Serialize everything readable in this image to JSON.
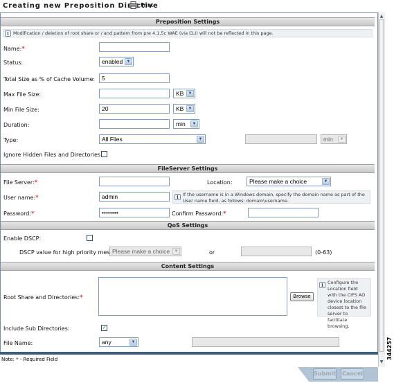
{
  "title": "Creating new Preposition Directive",
  "print_label": "Print",
  "note": "Modification / deletion of root share or / and pattern from pre 4.1.5c WAE (via CLI) will not be reflected in this page.",
  "sections": {
    "preposition": "Preposition Settings",
    "fileserver": "FileServer Settings",
    "qos": "QoS Settings",
    "content": "Content Settings"
  },
  "fields": {
    "name_label": "Name:",
    "name_value": "",
    "status_label": "Status:",
    "status_value": "enabled",
    "total_size_label": "Total Size as % of Cache Volume:",
    "total_size_value": "5",
    "max_file_label": "Max File Size:",
    "max_file_value": "",
    "max_file_unit": "KB",
    "min_file_label": "Min File Size:",
    "min_file_value": "20",
    "min_file_unit": "KB",
    "duration_label": "Duration:",
    "duration_value": "",
    "duration_unit": "min",
    "type_label": "Type:",
    "type_value": "All Files",
    "type_extra_unit": "min",
    "ignore_hidden_label": "Ignore Hidden Files and Directories:",
    "file_server_label": "File Server:",
    "file_server_value": "",
    "location_label": "Location:",
    "location_value": "Please make a choice",
    "username_label": "User name:",
    "username_value": "admin",
    "username_hint": "If the username is in a Windows domain, specify the domain name as part of the User name field, as follows: domain\\username.",
    "password_label": "Password:",
    "password_value": "••••••••",
    "confirm_password_label": "Confirm Password:",
    "confirm_password_value": "",
    "enable_dscp_label": "Enable DSCP:",
    "dscp_value_label": "DSCP value for high priority messages:",
    "dscp_value_select": "Please make a choice",
    "or_label": "or",
    "dscp_range": "(0-63)",
    "root_share_label": "Root Share and Directories:",
    "browse_label": "Browse",
    "browse_hint": "Configure the Location field with the CIFS AO device location closest to the file server to facilitate browsing.",
    "include_sub_label": "Include Sub Directories:",
    "file_name_label": "File Name:",
    "file_name_select": "any"
  },
  "required_note": "Note: * - Required Field",
  "buttons": {
    "submit": "Submit",
    "cancel": "Cancel"
  },
  "figure_id": "344257",
  "checkboxes": {
    "ignore_hidden": false,
    "enable_dscp": false,
    "include_sub": true
  }
}
